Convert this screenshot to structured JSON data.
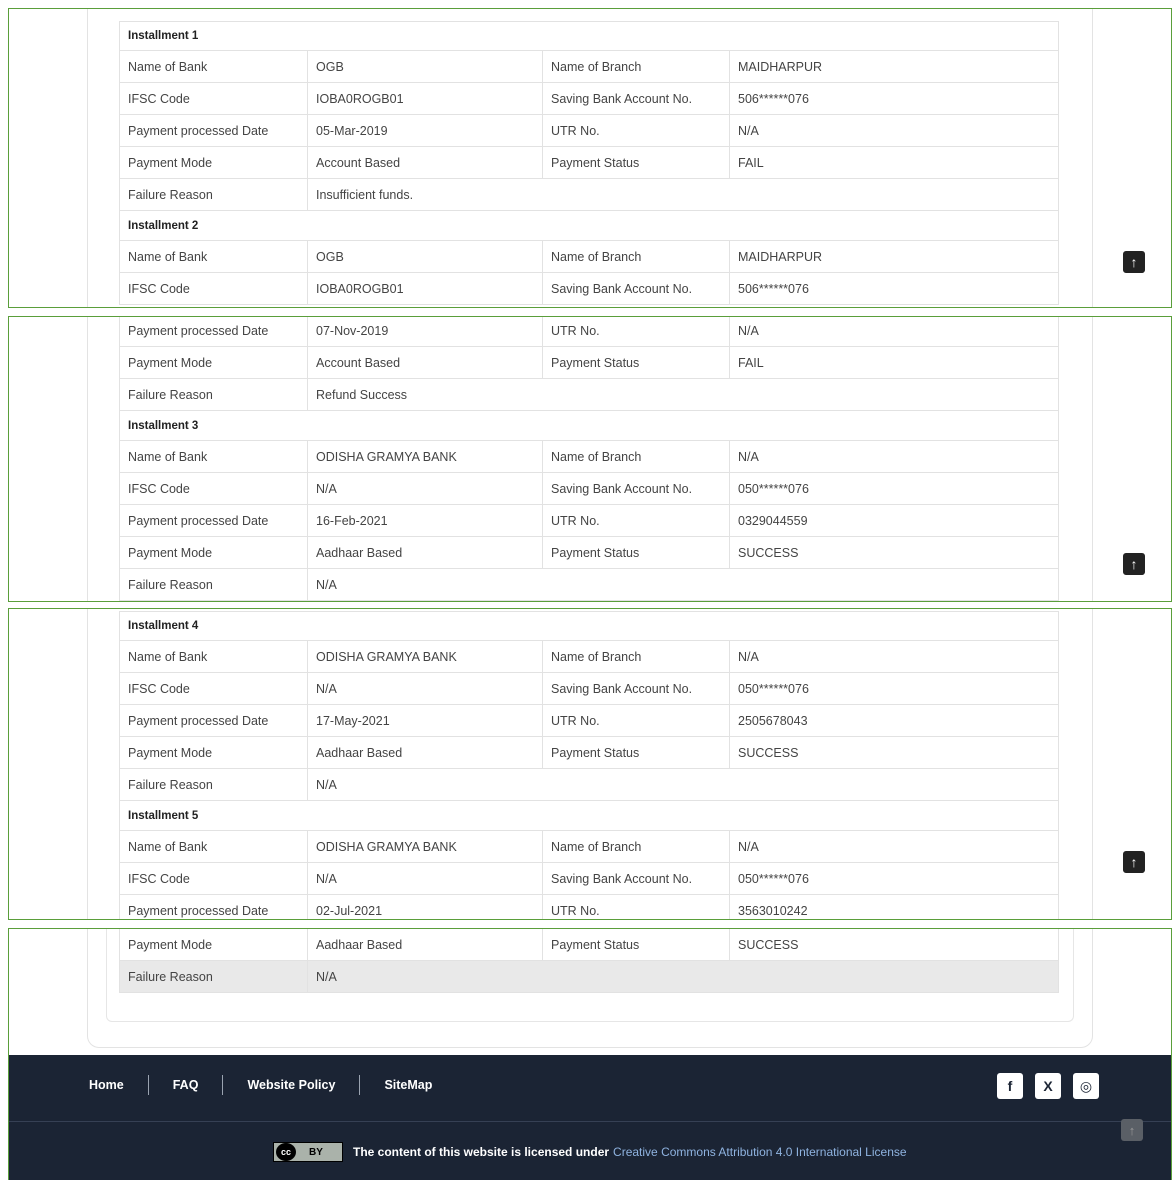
{
  "labels": {
    "name_of_bank": "Name of Bank",
    "name_of_branch": "Name of Branch",
    "ifsc_code": "IFSC Code",
    "saving_account": "Saving Bank Account No.",
    "payment_date": "Payment processed Date",
    "utr_no": "UTR No.",
    "payment_mode": "Payment Mode",
    "payment_status": "Payment Status",
    "failure_reason": "Failure Reason"
  },
  "installments": [
    {
      "title": "Installment 1",
      "bank": "OGB",
      "branch": "MAIDHARPUR",
      "ifsc": "IOBA0ROGB01",
      "account": "506******076",
      "date": "05-Mar-2019",
      "utr": "N/A",
      "mode": "Account Based",
      "status": "FAIL",
      "failure": "Insufficient funds."
    },
    {
      "title": "Installment 2",
      "bank": "OGB",
      "branch": "MAIDHARPUR",
      "ifsc": "IOBA0ROGB01",
      "account": "506******076",
      "date": "07-Nov-2019",
      "utr": "N/A",
      "mode": "Account Based",
      "status": "FAIL",
      "failure": "Refund Success"
    },
    {
      "title": "Installment 3",
      "bank": "ODISHA GRAMYA BANK",
      "branch": "N/A",
      "ifsc": "N/A",
      "account": "050******076",
      "date": "16-Feb-2021",
      "utr": "0329044559",
      "mode": "Aadhaar Based",
      "status": "SUCCESS",
      "failure": "N/A"
    },
    {
      "title": "Installment 4",
      "bank": "ODISHA GRAMYA BANK",
      "branch": "N/A",
      "ifsc": "N/A",
      "account": "050******076",
      "date": "17-May-2021",
      "utr": "2505678043",
      "mode": "Aadhaar Based",
      "status": "SUCCESS",
      "failure": "N/A"
    },
    {
      "title": "Installment 5",
      "bank": "ODISHA GRAMYA BANK",
      "branch": "N/A",
      "ifsc": "N/A",
      "account": "050******076",
      "date": "02-Jul-2021",
      "utr": "3563010242",
      "mode": "Aadhaar Based",
      "status": "SUCCESS",
      "failure": "N/A"
    }
  ],
  "scroll_top_glyph": "↑",
  "footer": {
    "links": [
      "Home",
      "FAQ",
      "Website Policy",
      "SiteMap"
    ],
    "social_icons": [
      "facebook-icon",
      "x-icon",
      "instagram-icon"
    ],
    "social_glyphs": [
      "f",
      "X",
      "◎"
    ],
    "cc_badge": [
      "cc",
      "BY"
    ],
    "license_text": "The content of this website is licensed under",
    "license_link": "Creative Commons Attribution 4.0 International License"
  },
  "colors": {
    "panel_border": "#5a9e3a",
    "footer_bg": "#1b2434",
    "license_link": "#8fb3e0"
  }
}
